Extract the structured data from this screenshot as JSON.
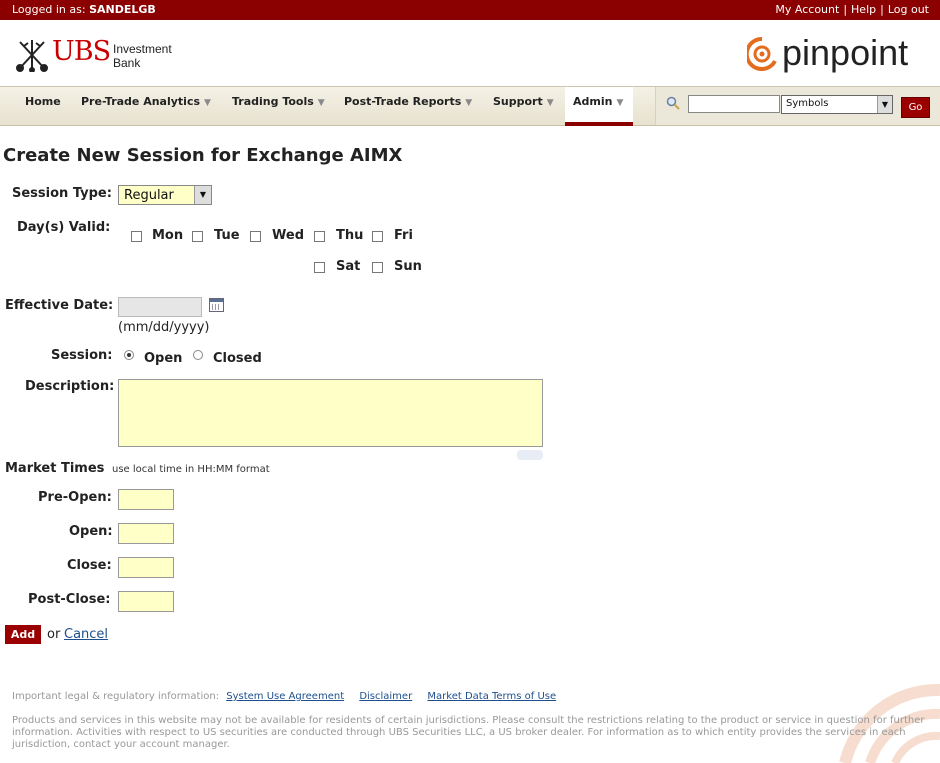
{
  "topbar": {
    "login_prefix": "Logged in as:",
    "username": "SANDELGB",
    "my_account": "My Account",
    "help": "Help",
    "logout": "Log out"
  },
  "header": {
    "ubs_word": "UBS",
    "ubs_sub_line1": "Investment",
    "ubs_sub_line2": "Bank",
    "pinpoint": "pinpoint"
  },
  "nav": {
    "tabs": [
      {
        "label": "Home"
      },
      {
        "label": "Pre-Trade Analytics"
      },
      {
        "label": "Trading Tools"
      },
      {
        "label": "Post-Trade Reports"
      },
      {
        "label": "Support"
      },
      {
        "label": "Admin"
      }
    ],
    "search_value": "",
    "symbols_selected": "Symbols",
    "go_label": "Go"
  },
  "form": {
    "title": "Create New Session for Exchange AIMX",
    "session_type_label": "Session Type:",
    "session_type_value": "Regular",
    "days_label": "Day(s) Valid:",
    "days": [
      "Mon",
      "Tue",
      "Wed",
      "Thu",
      "Fri",
      "Sat",
      "Sun"
    ],
    "effective_date_label": "Effective Date:",
    "effective_date_value": "",
    "date_format_hint": "(mm/dd/yyyy)",
    "session_label": "Session:",
    "session_open": "Open",
    "session_closed": "Closed",
    "session_selected": "Open",
    "description_label": "Description:",
    "description_value": "",
    "market_times_title": "Market Times",
    "market_times_hint": "use local time in HH:MM format",
    "pre_open_label": "Pre-Open:",
    "open_label": "Open:",
    "close_label": "Close:",
    "post_close_label": "Post-Close:",
    "add_label": "Add",
    "or_text": "or",
    "cancel_label": "Cancel"
  },
  "footer": {
    "legal_prefix": "Important legal & regulatory information:",
    "links": [
      "System Use Agreement",
      "Disclaimer",
      "Market Data Terms of Use"
    ],
    "fine_print": "Products and services in this website may not be available for residents of certain jurisdictions. Please consult the restrictions relating to the product or service in question for further information. Activities with respect to US securities are conducted through UBS Securities LLC, a US broker dealer. For information as to which entity provides the services in each jurisdiction, contact your account manager."
  },
  "colors": {
    "brand_red": "#8b0000",
    "field_yellow": "#ffffc8",
    "link_blue": "#1d4f8e",
    "pinpoint_orange": "#e36c1e"
  }
}
